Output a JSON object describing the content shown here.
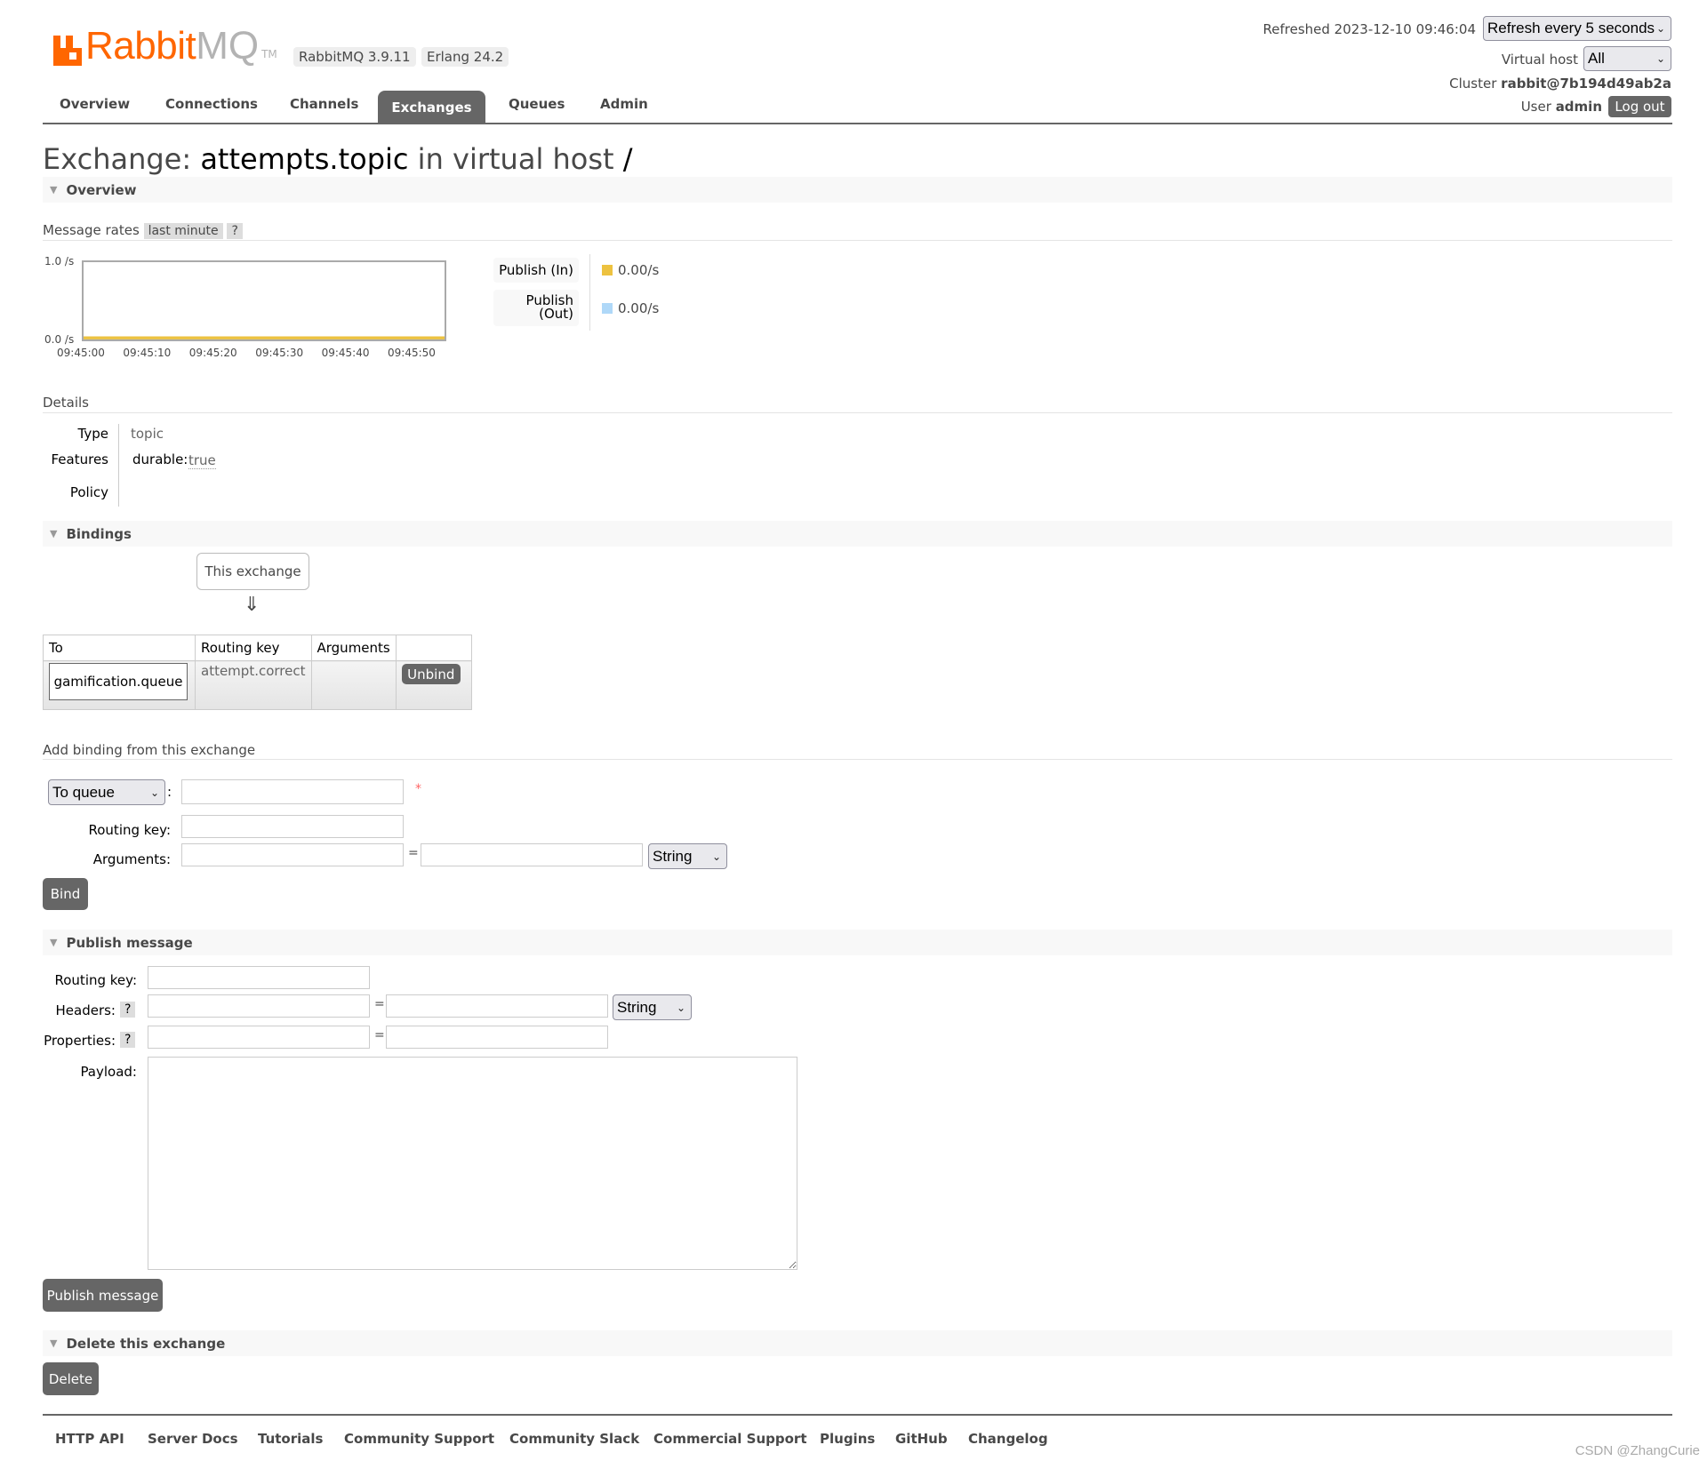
{
  "header": {
    "logo_text_rabbit": "Rabbit",
    "logo_text_mq": "MQ",
    "logo_tm": "TM",
    "version_badge": "RabbitMQ 3.9.11",
    "erlang_badge": "Erlang 24.2",
    "refreshed_text": "Refreshed 2023-12-10 09:46:04",
    "refresh_select": "Refresh every 5 seconds",
    "vhost_label": "Virtual host",
    "vhost_select": "All",
    "cluster_label": "Cluster",
    "cluster_value": "rabbit@7b194d49ab2a",
    "user_label": "User",
    "user_value": "admin",
    "logout_label": "Log out"
  },
  "nav": {
    "tabs": [
      {
        "label": "Overview"
      },
      {
        "label": "Connections"
      },
      {
        "label": "Channels"
      },
      {
        "label": "Exchanges",
        "active": true
      },
      {
        "label": "Queues"
      },
      {
        "label": "Admin"
      }
    ]
  },
  "page": {
    "title_prefix": "Exchange:",
    "exchange_name": "attempts.topic",
    "title_middle": "in virtual host",
    "vhost": "/"
  },
  "overview": {
    "section_label": "Overview",
    "message_rates_label": "Message rates",
    "range_badge": "last minute",
    "help_badge": "?",
    "legend": [
      {
        "label": "Publish (In)",
        "value": "0.00/s",
        "color": "#edc240"
      },
      {
        "label_line1": "Publish",
        "label_line2": "(Out)",
        "value": "0.00/s",
        "color": "#afd8f8"
      }
    ]
  },
  "chart_data": {
    "type": "line",
    "title": "Message rates",
    "xlabel": "",
    "ylabel": "",
    "x": [
      "09:45:00",
      "09:45:10",
      "09:45:20",
      "09:45:30",
      "09:45:40",
      "09:45:50"
    ],
    "ylim": [
      0,
      1.0
    ],
    "ytick_labels": [
      "0.0 /s",
      "1.0 /s"
    ],
    "series": [
      {
        "name": "Publish (In)",
        "color": "#edc240",
        "values": [
          0,
          0,
          0,
          0,
          0,
          0
        ]
      },
      {
        "name": "Publish (Out)",
        "color": "#afd8f8",
        "values": [
          0,
          0,
          0,
          0,
          0,
          0
        ]
      }
    ],
    "grid": false,
    "legend": "right"
  },
  "details": {
    "heading": "Details",
    "type_label": "Type",
    "type_value": "topic",
    "features_label": "Features",
    "durable_key": "durable:",
    "durable_value": "true",
    "policy_label": "Policy"
  },
  "bindings": {
    "section_label": "Bindings",
    "this_exchange": "This exchange",
    "arrow": "⇓",
    "columns": [
      "To",
      "Routing key",
      "Arguments",
      ""
    ],
    "rows": [
      {
        "to": "gamification.queue",
        "routing_key": "attempt.correct",
        "arguments": "",
        "action": "Unbind"
      }
    ]
  },
  "add_binding": {
    "heading": "Add binding from this exchange",
    "dest_select": "To queue",
    "colon": ":",
    "required_mark": "*",
    "routing_key_label": "Routing key:",
    "arguments_label": "Arguments:",
    "equals": "=",
    "type_select": "String",
    "bind_label": "Bind"
  },
  "publish": {
    "section_label": "Publish message",
    "routing_key_label": "Routing key:",
    "headers_label": "Headers:",
    "properties_label": "Properties:",
    "help": "?",
    "equals": "=",
    "type_select": "String",
    "payload_label": "Payload:",
    "publish_label": "Publish message"
  },
  "delete": {
    "section_label": "Delete this exchange",
    "delete_label": "Delete"
  },
  "footer": {
    "links": [
      "HTTP API",
      "Server Docs",
      "Tutorials",
      "Community Support",
      "Community Slack",
      "Commercial Support",
      "Plugins",
      "GitHub",
      "Changelog"
    ],
    "watermark": "CSDN @ZhangCurie"
  }
}
